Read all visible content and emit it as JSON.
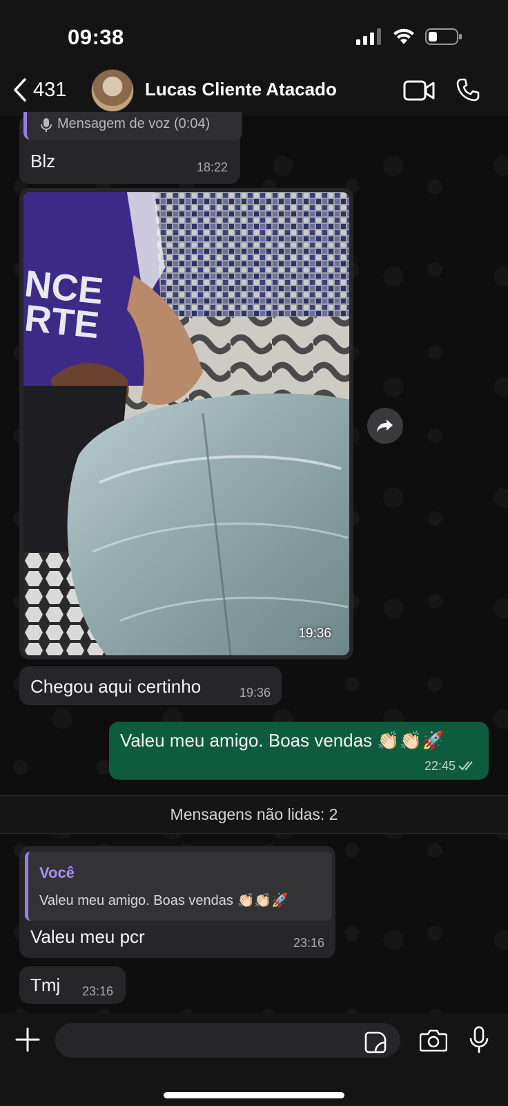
{
  "status_bar": {
    "time": "09:38"
  },
  "header": {
    "back_count": "431",
    "contact_name": "Lucas Cliente Atacado"
  },
  "messages": {
    "voice_quote_label": "Mensagem de voz (0:04)",
    "blz": {
      "text": "Blz",
      "time": "18:22"
    },
    "photo": {
      "time": "19:36"
    },
    "chegou": {
      "text": "Chegou aqui certinho",
      "time": "19:36"
    },
    "valeu_out": {
      "text": "Valeu meu amigo. Boas vendas 👏🏻👏🏻🚀",
      "time": "22:45"
    },
    "unread_label": "Mensagens não lidas: 2",
    "reply": {
      "quote_author": "Você",
      "quote_text": "Valeu meu amigo. Boas vendas 👏🏻👏🏻🚀",
      "text": "Valeu meu pcr",
      "time": "23:16"
    },
    "tmj": {
      "text": "Tmj",
      "time": "23:16"
    }
  },
  "input": {
    "placeholder": ""
  },
  "colors": {
    "incoming_bubble": "#262628",
    "outgoing_bubble": "#0e5c3f",
    "reply_accent": "#9a7be6"
  },
  "icons": [
    "back-chevron-icon",
    "video-call-icon",
    "phone-call-icon",
    "forward-icon",
    "plus-icon",
    "sticker-icon",
    "camera-icon",
    "microphone-icon",
    "read-receipt-icon",
    "signal-icon",
    "wifi-icon",
    "battery-icon"
  ]
}
